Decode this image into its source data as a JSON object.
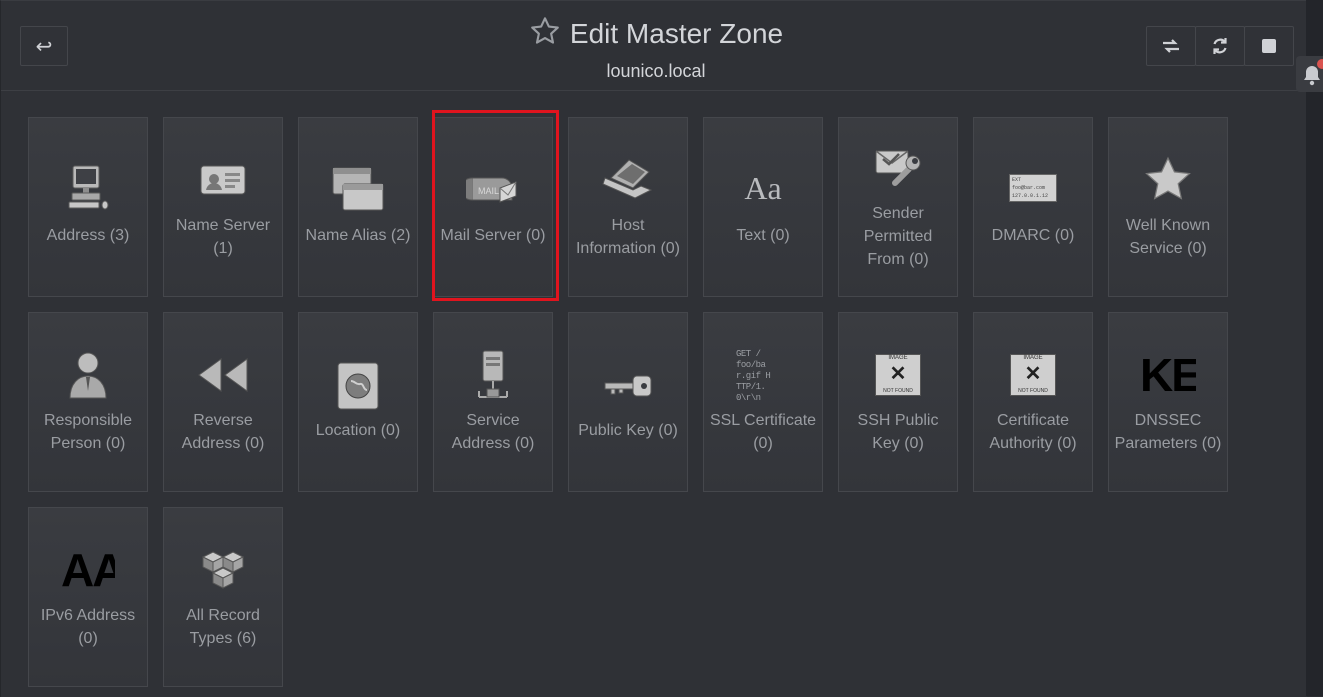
{
  "header": {
    "title": "Edit Master Zone",
    "subtitle": "lounico.local",
    "back_icon": "↩",
    "buttons": [
      {
        "name": "swap-icon",
        "glyph": "⇆"
      },
      {
        "name": "refresh-icon",
        "glyph": "⟳"
      },
      {
        "name": "stop-icon",
        "glyph": "■"
      }
    ]
  },
  "tiles": [
    {
      "label": "Address (3)",
      "icon": "computer-icon"
    },
    {
      "label": "Name Server (1)",
      "icon": "id-card-icon"
    },
    {
      "label": "Name Alias (2)",
      "icon": "windows-icon"
    },
    {
      "label": "Mail Server (0)",
      "icon": "mailbox-icon"
    },
    {
      "label": "Host Information (0)",
      "icon": "laptop-icon"
    },
    {
      "label": "Text (0)",
      "icon": "text-aa-icon",
      "glyph": "Aa"
    },
    {
      "label": "Sender Permitted From (0)",
      "icon": "envelope-wrench-icon"
    },
    {
      "label": "DMARC (0)",
      "icon": "dmarc-card-icon",
      "card_lines": [
        "EXT",
        "foo@bar.com",
        "127.0.0.1.12"
      ]
    },
    {
      "label": "Well Known Service (0)",
      "icon": "star-icon"
    },
    {
      "label": "Responsible Person (0)",
      "icon": "person-icon"
    },
    {
      "label": "Reverse Address (0)",
      "icon": "rewind-icon"
    },
    {
      "label": "Location (0)",
      "icon": "globe-icon"
    },
    {
      "label": "Service Address (0)",
      "icon": "server-icon"
    },
    {
      "label": "Public Key (0)",
      "icon": "key-icon"
    },
    {
      "label": "SSL Certificate (0)",
      "icon": "ssl-text-icon",
      "text_lines": [
        "GET /",
        "foo/ba",
        "r.gif H",
        "TTP/1.",
        "0\\r\\n"
      ]
    },
    {
      "label": "SSH Public Key (0)",
      "icon": "image-not-found-icon",
      "top_text": "IMAGE",
      "bottom_text": "NOT FOUND"
    },
    {
      "label": "Certificate Authority (0)",
      "icon": "image-not-found-icon",
      "top_text": "IMAGE",
      "bottom_text": "NOT FOUND"
    },
    {
      "label": "DNSSEC Parameters (0)",
      "icon": "dnssec-ke-icon",
      "glyph": "KE"
    },
    {
      "label": "IPv6 Address (0)",
      "icon": "ipv6-aa-icon",
      "glyph": "AA"
    },
    {
      "label": "All Record Types (6)",
      "icon": "cubes-icon"
    }
  ],
  "colors": {
    "background": "#2f3136",
    "tile": "#3a3c41",
    "text": "#9a9da2",
    "title": "#d3d5d9",
    "highlight": "#e0141e",
    "notification": "#d9534f"
  }
}
